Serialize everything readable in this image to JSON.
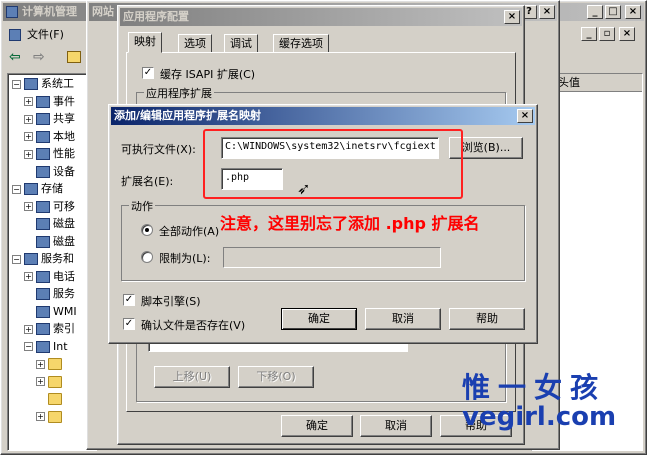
{
  "bg_window": {
    "title": "计算机管理",
    "menu_file": "文件(F)",
    "tree": [
      {
        "expander": "minus",
        "label": "系统工",
        "icon": "computer-icon",
        "indent": 0
      },
      {
        "expander": "plus",
        "label": "事件",
        "icon": "event-viewer-icon",
        "indent": 1
      },
      {
        "expander": "plus",
        "label": "共享",
        "icon": "shared-folder-icon",
        "indent": 1
      },
      {
        "expander": "plus",
        "label": "本地",
        "icon": "users-icon",
        "indent": 1
      },
      {
        "expander": "plus",
        "label": "性能",
        "icon": "performance-icon",
        "indent": 1
      },
      {
        "expander": "",
        "label": "设备",
        "icon": "device-manager-icon",
        "indent": 1
      },
      {
        "expander": "minus",
        "label": "存储",
        "icon": "storage-icon",
        "indent": 0
      },
      {
        "expander": "plus",
        "label": "可移",
        "icon": "removable-storage-icon",
        "indent": 1
      },
      {
        "expander": "",
        "label": "磁盘",
        "icon": "disk-defrag-icon",
        "indent": 1
      },
      {
        "expander": "",
        "label": "磁盘",
        "icon": "disk-management-icon",
        "indent": 1
      },
      {
        "expander": "minus",
        "label": "服务和",
        "icon": "services-apps-icon",
        "indent": 0
      },
      {
        "expander": "plus",
        "label": "电话",
        "icon": "telephony-icon",
        "indent": 1
      },
      {
        "expander": "",
        "label": "服务",
        "icon": "services-icon",
        "indent": 1
      },
      {
        "expander": "",
        "label": "WMI",
        "icon": "wmi-icon",
        "indent": 1
      },
      {
        "expander": "plus",
        "label": "索引",
        "icon": "indexing-icon",
        "indent": 1
      },
      {
        "expander": "minus",
        "label": "Int",
        "icon": "iis-icon",
        "indent": 1
      },
      {
        "expander": "plus",
        "label": "",
        "icon": "folder-icon",
        "indent": 2
      },
      {
        "expander": "plus",
        "label": "",
        "icon": "folder-icon",
        "indent": 2
      },
      {
        "expander": "",
        "label": "",
        "icon": "folder-icon",
        "indent": 2
      },
      {
        "expander": "plus",
        "label": "",
        "icon": "folder-icon",
        "indent": 2
      }
    ],
    "right_header": "主机头值"
  },
  "site_window": {
    "title": "网站",
    "move_up": "上移(U)",
    "move_down": "下移(O)",
    "ok": "确定",
    "cancel": "取消",
    "help": "帮助"
  },
  "app_config": {
    "title": "应用程序配置",
    "tabs": [
      "映射",
      "选项",
      "调试",
      "缓存选项"
    ],
    "cache_isapi": "缓存 ISAPI 扩展(C)",
    "app_ext_group": "应用程序扩展"
  },
  "dialog": {
    "title": "添加/编辑应用程序扩展名映射",
    "exe_label": "可执行文件(X):",
    "exe_value": "C:\\WINDOWS\\system32\\inetsrv\\fcgiext.",
    "browse": "浏览(B)...",
    "ext_label": "扩展名(E):",
    "ext_value": ".php",
    "verbs_group": "动作",
    "all_verbs": "全部动作(A)",
    "limit_to": "限制为(L):",
    "script_engine": "脚本引擎(S)",
    "verify_file": "确认文件是否存在(V)",
    "ok": "确定",
    "cancel": "取消",
    "help": "帮助"
  },
  "annotation": {
    "text": "注意，这里别忘了添加 .php 扩展名",
    "color": "#ff0000"
  },
  "watermark": {
    "line1": "惟一女孩",
    "line2": "vegirl.com",
    "color": "#1a3fb0"
  }
}
